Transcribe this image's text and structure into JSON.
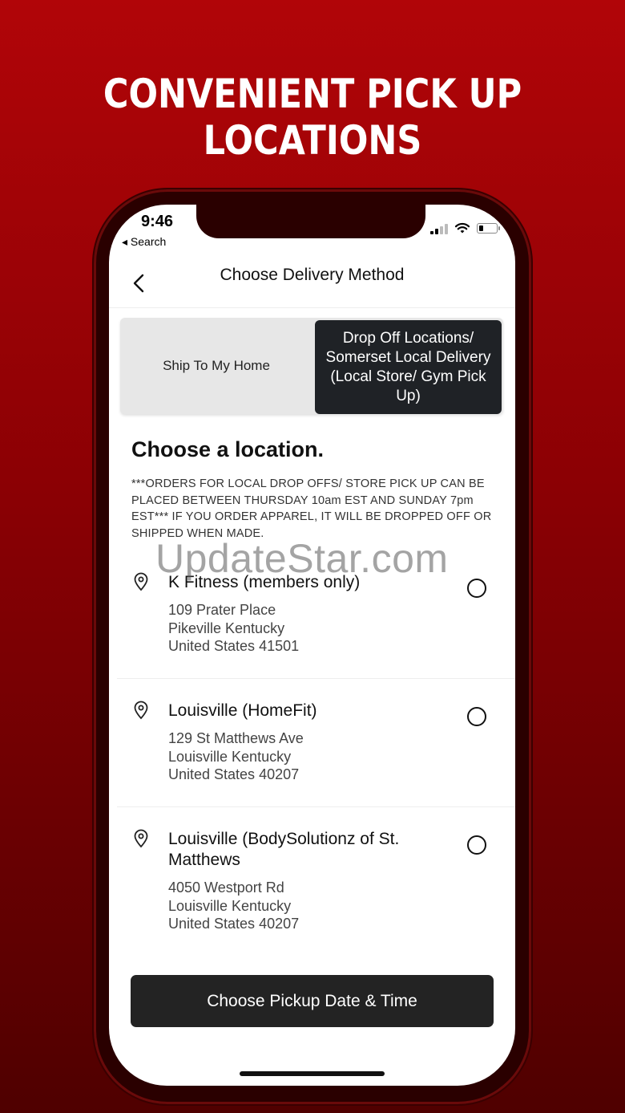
{
  "headline": "CONVENIENT PICK UP LOCATIONS",
  "status_bar": {
    "time": "9:46",
    "back_label": "◂ Search"
  },
  "nav": {
    "title": "Choose Delivery Method"
  },
  "delivery_options": {
    "ship_home": "Ship To My Home",
    "drop_off": "Drop Off Locations/ Somerset Local Delivery (Local Store/ Gym Pick Up)"
  },
  "section": {
    "title": "Choose a location.",
    "notice": "***ORDERS FOR LOCAL DROP OFFS/ STORE PICK UP CAN BE PLACED BETWEEN THURSDAY 10am EST AND SUNDAY 7pm EST*** IF YOU ORDER APPAREL, IT WILL BE DROPPED OFF OR SHIPPED WHEN MADE."
  },
  "watermark": "UpdateStar.com",
  "locations": [
    {
      "name": "K Fitness (members only)",
      "line1": "109 Prater Place",
      "line2": "Pikeville Kentucky",
      "line3": "United States 41501"
    },
    {
      "name": "Louisville (HomeFit)",
      "line1": "129 St Matthews Ave",
      "line2": "Louisville Kentucky",
      "line3": "United States 40207"
    },
    {
      "name": "Louisville (BodySolutionz of St. Matthews",
      "line1": "4050 Westport Rd",
      "line2": "Louisville Kentucky",
      "line3": "United States 40207"
    }
  ],
  "cta_label": "Choose Pickup Date & Time"
}
